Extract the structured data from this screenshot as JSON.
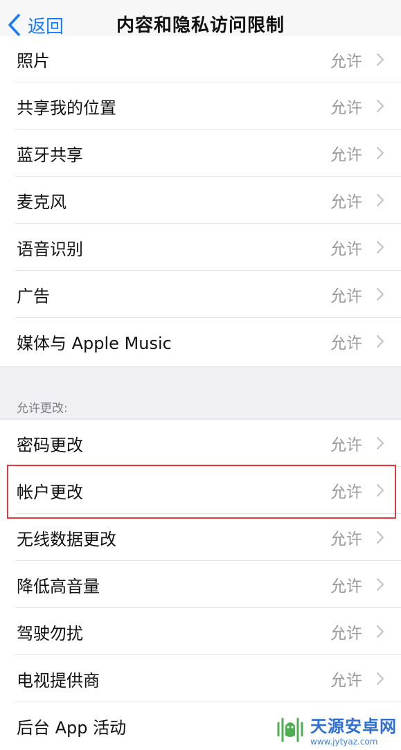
{
  "navbar": {
    "back_label": "返回",
    "title": "内容和隐私访问限制"
  },
  "colors": {
    "accent": "#1a7cf5",
    "highlight": "#e0393e",
    "secondary_text": "#9a9aa0"
  },
  "group1": {
    "items": [
      {
        "label": "照片",
        "value": "允许"
      },
      {
        "label": "共享我的位置",
        "value": "允许"
      },
      {
        "label": "蓝牙共享",
        "value": "允许"
      },
      {
        "label": "麦克风",
        "value": "允许"
      },
      {
        "label": "语音识别",
        "value": "允许"
      },
      {
        "label": "广告",
        "value": "允许"
      },
      {
        "label": "媒体与 Apple Music",
        "value": "允许"
      }
    ]
  },
  "group2": {
    "header": "允许更改:",
    "items": [
      {
        "label": "密码更改",
        "value": "允许"
      },
      {
        "label": "帐户更改",
        "value": "允许"
      },
      {
        "label": "无线数据更改",
        "value": "允许"
      },
      {
        "label": "降低高音量",
        "value": "允许"
      },
      {
        "label": "驾驶勿扰",
        "value": "允许"
      },
      {
        "label": "电视提供商",
        "value": "允许"
      },
      {
        "label": "后台 App 活动",
        "value": ""
      }
    ]
  },
  "watermark": {
    "name": "天源安卓网",
    "url": "www.jytyaz.com"
  }
}
